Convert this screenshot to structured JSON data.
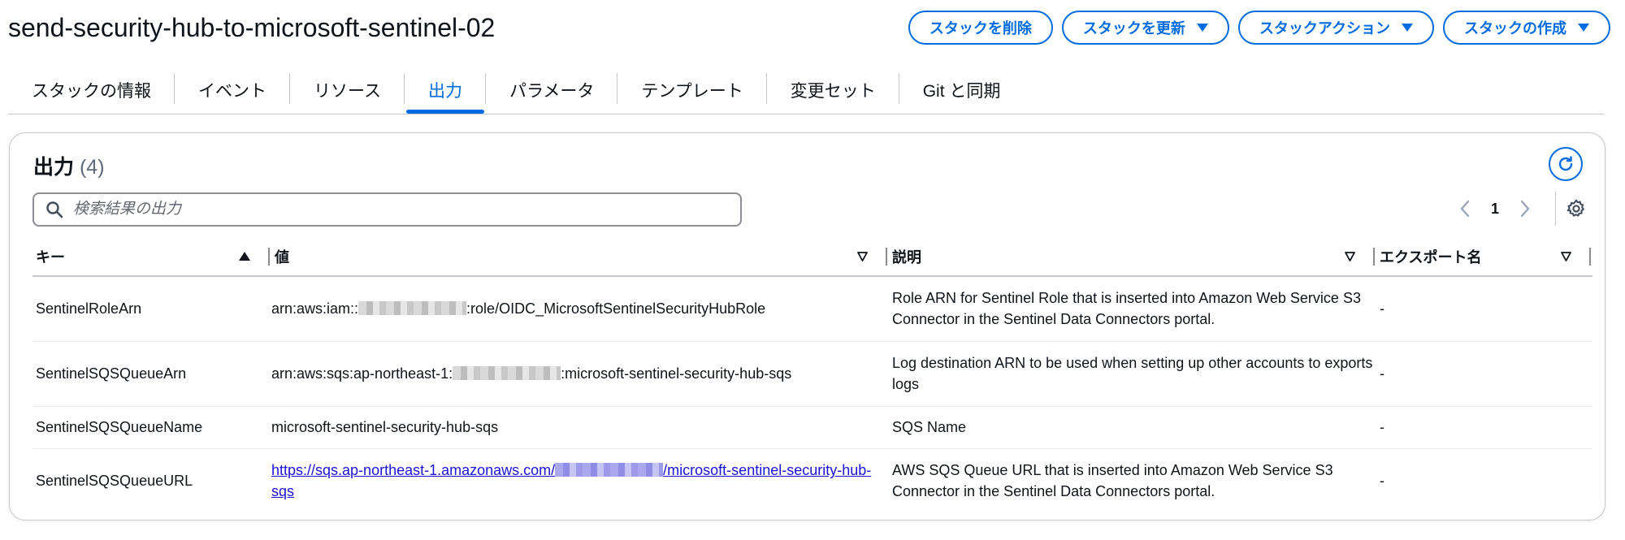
{
  "stack": {
    "name": "send-security-hub-to-microsoft-sentinel-02"
  },
  "actions": {
    "delete": "スタックを削除",
    "update": "スタックを更新",
    "stack_actions": "スタックアクション",
    "create": "スタックの作成"
  },
  "tabs": [
    {
      "label": "スタックの情報",
      "active": false
    },
    {
      "label": "イベント",
      "active": false
    },
    {
      "label": "リソース",
      "active": false
    },
    {
      "label": "出力",
      "active": true
    },
    {
      "label": "パラメータ",
      "active": false
    },
    {
      "label": "テンプレート",
      "active": false
    },
    {
      "label": "変更セット",
      "active": false
    },
    {
      "label": "Git と同期",
      "active": false
    }
  ],
  "panel": {
    "title": "出力",
    "count": "(4)"
  },
  "search": {
    "placeholder": "検索結果の出力"
  },
  "pagination": {
    "current_page": "1"
  },
  "table": {
    "columns": [
      "キー",
      "値",
      "説明",
      "エクスポート名"
    ],
    "rows": [
      {
        "key": "SentinelRoleArn",
        "value_prefix": "arn:aws:iam::",
        "value_suffix": ":role/OIDC_MicrosoftSentinelSecurityHubRole",
        "description": "Role ARN for Sentinel Role that is inserted into Amazon Web Service S3 Connector in the Sentinel Data Connectors portal.",
        "export": "-"
      },
      {
        "key": "SentinelSQSQueueArn",
        "value_prefix": "arn:aws:sqs:ap-northeast-1:",
        "value_suffix": ":microsoft-sentinel-security-hub-sqs",
        "description": "Log destination ARN to be used when setting up other accounts to exports logs",
        "export": "-"
      },
      {
        "key": "SentinelSQSQueueName",
        "value": "microsoft-sentinel-security-hub-sqs",
        "description": "SQS Name",
        "export": "-"
      },
      {
        "key": "SentinelSQSQueueURL",
        "value_prefix": "https://sqs.ap-northeast-1.amazonaws.com/",
        "value_suffix": "/microsoft-sentinel-security-hub-sqs",
        "description": "AWS SQS Queue URL that is inserted into Amazon Web Service S3 Connector in the Sentinel Data Connectors portal.",
        "export": "-"
      }
    ]
  },
  "icons": {
    "search": "search-icon",
    "refresh": "refresh-icon",
    "settings": "gear-icon",
    "prev": "chevron-left-icon",
    "next": "chevron-right-icon"
  },
  "colors": {
    "accent": "#006ce0",
    "link": "#1a12d6",
    "text": "#0f141a",
    "muted": "#5f6b7a",
    "border": "#c6c6cd"
  }
}
